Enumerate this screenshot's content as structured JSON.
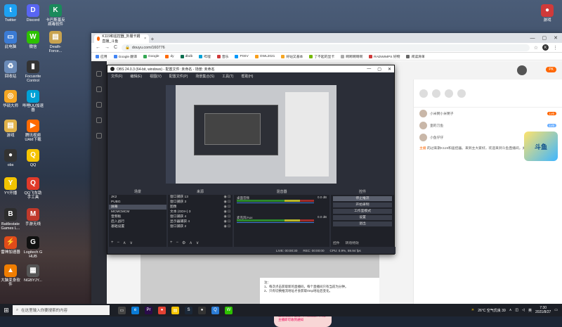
{
  "desktop": {
    "icons": [
      {
        "label": "Twitter",
        "color": "#1da1f2",
        "glyph": "t"
      },
      {
        "label": "Discord",
        "color": "#5865f2",
        "glyph": "D"
      },
      {
        "label": "卡巴斯基反病毒软件",
        "color": "#1a8a5b",
        "glyph": "K"
      },
      {
        "label": "此电脑",
        "color": "#3b7bd4",
        "glyph": "▭"
      },
      {
        "label": "微信",
        "color": "#2dc100",
        "glyph": "W"
      },
      {
        "label": "Death-Force...",
        "color": "#c9a34f",
        "glyph": "▤"
      },
      {
        "label": "回收站",
        "color": "#6b8bb8",
        "glyph": "♻"
      },
      {
        "label": "Focusrite Control",
        "color": "#333",
        "glyph": "▮"
      },
      {
        "label": "华硕大师",
        "color": "#f5a623",
        "glyph": "◎"
      },
      {
        "label": "哔哩UU加速器",
        "color": "#00a1d6",
        "glyph": "U"
      },
      {
        "label": "游戏",
        "color": "#e0b24a",
        "glyph": "▤"
      },
      {
        "label": "腾讯视频 UAM下载",
        "color": "#ff6a00",
        "glyph": "▶"
      },
      {
        "label": "obs",
        "color": "#333",
        "glyph": "●"
      },
      {
        "label": "QQ",
        "color": "#f5c400",
        "glyph": "Q"
      },
      {
        "label": "YY开播",
        "color": "#f2c400",
        "glyph": "Y"
      },
      {
        "label": "QQ飞车助手工具",
        "color": "#e03a2a",
        "glyph": "Q"
      },
      {
        "label": "Battlestate Games L...",
        "color": "#2d2d2d",
        "glyph": "B"
      },
      {
        "label": "手游无线",
        "color": "#c0392b",
        "glyph": "M"
      },
      {
        "label": "雷神加速器",
        "color": "#e04b1a",
        "glyph": "⚡"
      },
      {
        "label": "Logitech G HUB",
        "color": "#111",
        "glyph": "G"
      },
      {
        "label": "大脑变身软件",
        "color": "#ef7d00",
        "glyph": "▲"
      },
      {
        "label": "NGBYJY...",
        "color": "#555",
        "glyph": "▦"
      }
    ],
    "right_icon": {
      "label": "游戏",
      "color": "#d03a3a",
      "glyph": "●"
    }
  },
  "browser": {
    "tab_title": "K119和遥控器_外服卡姆直播_斗鱼",
    "new_tab": "+",
    "controls": [
      "—",
      "▢",
      "✕"
    ],
    "back": "←",
    "forward": "→",
    "reload": "C",
    "url": "douyu.com/160776",
    "profile": "K",
    "bookmarks": [
      {
        "label": "应用",
        "color": "#4285f4"
      },
      {
        "label": "Google 翻译",
        "color": "#4285f4"
      },
      {
        "label": "Google",
        "color": "#34a853"
      },
      {
        "label": "dy",
        "color": "#ff6a00"
      },
      {
        "label": "dbdb",
        "color": "#0b6e4f"
      },
      {
        "label": "哔哩",
        "color": "#00a1d6"
      },
      {
        "label": "音乐",
        "color": "#d03a3a"
      },
      {
        "label": "PIXIV",
        "color": "#0096fa"
      },
      {
        "label": "OWL2021",
        "color": "#f99e1a"
      },
      {
        "label": "好站又基本",
        "color": "#f5a623"
      },
      {
        "label": "了不起的显卡",
        "color": "#76b900"
      },
      {
        "label": "啊啊啊啊啊",
        "color": "#aaa"
      },
      {
        "label": "RADWIMPS 好物",
        "color": "#d03a3a"
      },
      {
        "label": "阅读清单",
        "color": "#666"
      }
    ]
  },
  "douyu": {
    "pk_badge": "PK",
    "rank": [
      {
        "name": "小米粥小米粥子",
        "level": "Lv6"
      },
      {
        "name": "歪的刀鱼",
        "level": "Lv5"
      },
      {
        "name": "小鱼仔仔",
        "level": "Lv3"
      }
    ],
    "chat_user": "主播",
    "chat_text": "的过来斯K119和遥控器。来到主大家好，欢迎来到斗鱼直播间，关注主播不迷路。",
    "player_text": "注：\n1、每次点击获取新的直播码，每个直播间只有当前为分钟。\n2、只有切换推流地址才会获取rtmp地址后变化。",
    "player_button": "确认",
    "promo": "主播设置了自定义开播提醒，关注主播即可收到通知",
    "banner": "斗鱼"
  },
  "obs": {
    "title": "OBS 24.0.3 (64-bit, windows) - 配置文件: 未命名 - 场景: 未命名",
    "menu": [
      "文件(F)",
      "编辑(E)",
      "视图(V)",
      "配置文件(P)",
      "场景集合(S)",
      "工具(T)",
      "帮助(H)"
    ],
    "controls": [
      "—",
      "▢",
      "✕"
    ],
    "scenes_header": "场景",
    "scenes": [
      "JK2",
      "PUBG",
      "屏幕",
      "MCMCMCM",
      "音频板",
      "后入战行",
      "基础设置"
    ],
    "sources_header": "来源",
    "sources": [
      "窗口捕获 13",
      "窗口捕获 3",
      "图像",
      "文本 (GDI+) 3",
      "窗口捕获 4",
      "显示器捕获 4",
      "窗口捕获 2"
    ],
    "mixer_header": "混音器",
    "mixer": [
      {
        "name": "桌面音频",
        "db": "0.0 dB"
      },
      {
        "name": "麦克风/Aux",
        "db": "0.0 dB"
      }
    ],
    "controls_header": "控件",
    "buttons": [
      {
        "label": "停止推流",
        "active": true
      },
      {
        "label": "开始录制",
        "active": false
      },
      {
        "label": "工作室模式",
        "active": false
      },
      {
        "label": "设置",
        "active": false
      },
      {
        "label": "退出",
        "active": false
      }
    ],
    "tabs": [
      "控件",
      "转场特效"
    ],
    "status": [
      "LIVE: 00:00:30",
      "REC: 00:00:00",
      "CPU: 0.9%, 59.94 fps"
    ]
  },
  "taskbar": {
    "start": "⊞",
    "search_placeholder": "在这里输入你要搜索的内容",
    "apps": [
      {
        "name": "task-view",
        "color": "#444",
        "glyph": "▭"
      },
      {
        "name": "edge",
        "color": "#0a7bd6",
        "glyph": "e"
      },
      {
        "name": "premiere",
        "color": "#2a0b4a",
        "glyph": "Pr"
      },
      {
        "name": "chrome",
        "color": "#e34133",
        "glyph": "●"
      },
      {
        "name": "explorer",
        "color": "#f5c400",
        "glyph": "▤"
      },
      {
        "name": "steam",
        "color": "#1b2838",
        "glyph": "S"
      },
      {
        "name": "obs",
        "color": "#333",
        "glyph": "●"
      },
      {
        "name": "qq",
        "color": "#2b7cd6",
        "glyph": "Q"
      },
      {
        "name": "wechat",
        "color": "#2dc100",
        "glyph": "W"
      }
    ],
    "weather": "26°C 空气优良 39",
    "time": "7:30",
    "date": "2021/8/27",
    "lang": "英"
  }
}
